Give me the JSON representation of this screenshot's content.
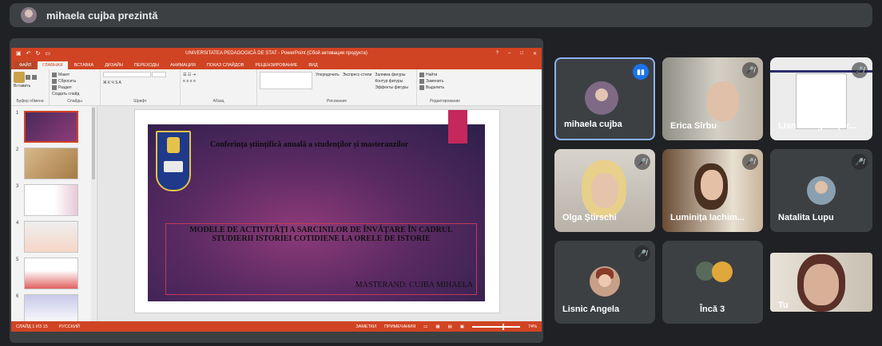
{
  "presenter_bar": {
    "title": "mihaela cujba prezintă"
  },
  "powerpoint": {
    "window_title": "UNIVERSITATEA PEDAGOGICĂ DE STAT - PowerPoint (Сбой активации продукта)",
    "tabs": [
      "ФАЙЛ",
      "ГЛАВНАЯ",
      "ВСТАВКА",
      "ДИЗАЙН",
      "ПЕРЕХОДЫ",
      "АНИМАЦИЯ",
      "ПОКАЗ СЛАЙДОВ",
      "РЕЦЕНЗИРОВАНИЕ",
      "ВИД"
    ],
    "groups": {
      "clipboard": {
        "label": "Буфер обмена",
        "paste": "Вставить"
      },
      "slides": {
        "label": "Слайды",
        "new": "Создать слайд",
        "layout": "Макет",
        "reset": "Сбросить",
        "section": "Раздел"
      },
      "font": {
        "label": "Шрифт"
      },
      "paragraph": {
        "label": "Абзац"
      },
      "drawing": {
        "label": "Рисование",
        "arrange": "Упорядочить",
        "quick": "Экспресс-стили",
        "fill": "Заливка фигуры",
        "outline": "Контур фигуры",
        "effects": "Эффекты фигуры"
      },
      "editing": {
        "label": "Редактирование",
        "find": "Найти",
        "replace": "Заменить",
        "select": "Выделить"
      }
    },
    "thumbnail_numbers": [
      "1",
      "2",
      "3",
      "4",
      "5",
      "6"
    ],
    "slide": {
      "title": "Conferința științifică anuală a studenților și masteranzilor",
      "main": "MODELE DE ACTIVITĂȚI A SARCINILOR DE ÎNVĂȚARE ÎN CADRUL STUDIERII ISTORIEI COTIDIENE LA ORELE DE ISTORIE",
      "author": "MASTERAND: CUJBA MIHAELA"
    },
    "status": {
      "slide": "СЛАЙД 1 ИЗ 15",
      "lang": "РУССКИЙ",
      "notes": "ЗАМЕТКИ",
      "comments": "ПРИМЕЧАНИЯ",
      "zoom": "74%"
    }
  },
  "participants": [
    {
      "name": "mihaela cujba",
      "state": "speaking"
    },
    {
      "name": "Erica Sîrbu",
      "state": "muted"
    },
    {
      "name": "Lisnic Angela (Pr...",
      "state": "muted"
    },
    {
      "name": "Olga Știrschi",
      "state": "muted"
    },
    {
      "name": "Luminița Iachim...",
      "state": "muted"
    },
    {
      "name": "Natalita Lupu",
      "state": "muted"
    },
    {
      "name": "Lisnic Angela",
      "state": "muted"
    },
    {
      "name": "Încă 3",
      "state": ""
    },
    {
      "name": "Tu",
      "state": ""
    }
  ],
  "colors": {
    "accent": "#8ab4f8",
    "ppt_red": "#d04423",
    "meet_bg": "#202124",
    "tile_bg": "#3c4043"
  },
  "icons": {
    "muted": "mic-off-icon",
    "speaking": "audio-bars-icon"
  }
}
